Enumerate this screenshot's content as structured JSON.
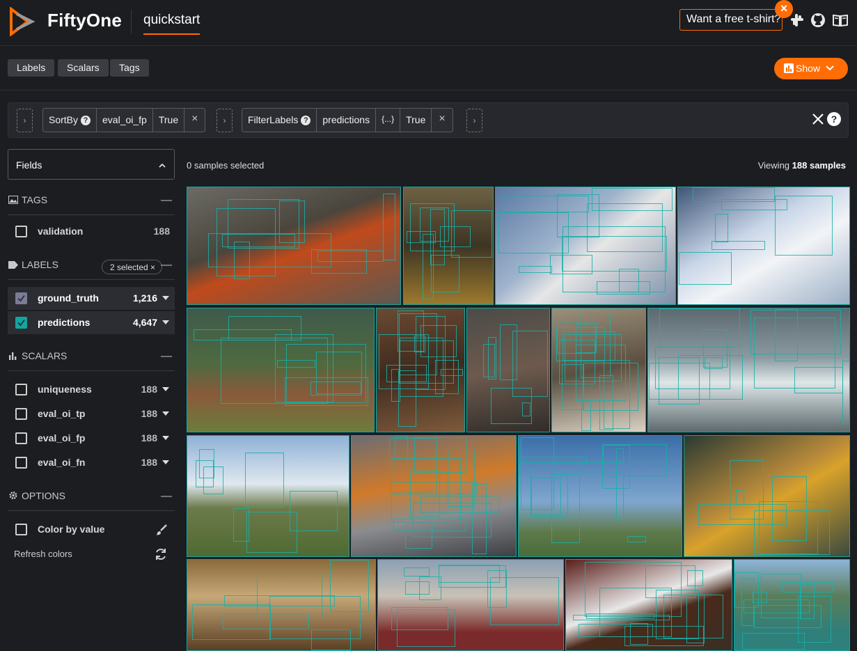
{
  "header": {
    "brand": "FiftyOne",
    "dataset": "quickstart",
    "tshirt": "Want a free t-shirt?",
    "icons": [
      "fiftyone-logo-icon",
      "close-icon",
      "slack-icon",
      "github-icon",
      "docs-book-icon"
    ]
  },
  "toolbar": {
    "tabs": [
      "Labels",
      "Scalars",
      "Tags"
    ],
    "show_label": "Show"
  },
  "viewbar": {
    "stage1": {
      "name": "SortBy",
      "arg1": "eval_oi_fp",
      "arg2": "True"
    },
    "stage2": {
      "name": "FilterLabels",
      "arg1": "predictions",
      "arg2": "{...}",
      "arg3": "True"
    }
  },
  "sidebar": {
    "fields_label": "Fields",
    "tags": {
      "title": "TAGS",
      "items": [
        {
          "label": "validation",
          "count": "188"
        }
      ]
    },
    "labels": {
      "title": "LABELS",
      "selected": "2 selected ×",
      "items": [
        {
          "label": "ground_truth",
          "count": "1,216",
          "checked": true,
          "color": "#7c7c96"
        },
        {
          "label": "predictions",
          "count": "4,647",
          "checked": true,
          "color": "#13a6a0"
        }
      ]
    },
    "scalars": {
      "title": "SCALARS",
      "items": [
        {
          "label": "uniqueness",
          "count": "188"
        },
        {
          "label": "eval_oi_tp",
          "count": "188"
        },
        {
          "label": "eval_oi_fp",
          "count": "188"
        },
        {
          "label": "eval_oi_fn",
          "count": "188"
        }
      ]
    },
    "options": {
      "title": "OPTIONS",
      "color_by_value": "Color by value",
      "refresh_colors": "Refresh colors"
    }
  },
  "grid": {
    "selected_text": "0 samples selected",
    "viewing_prefix": "Viewing",
    "viewing_count": "188 samples"
  },
  "colors": {
    "accent": "#ff6d04",
    "ground_truth": "#7c7c96",
    "predictions": "#13a6a0",
    "background": "#1c1d21"
  }
}
